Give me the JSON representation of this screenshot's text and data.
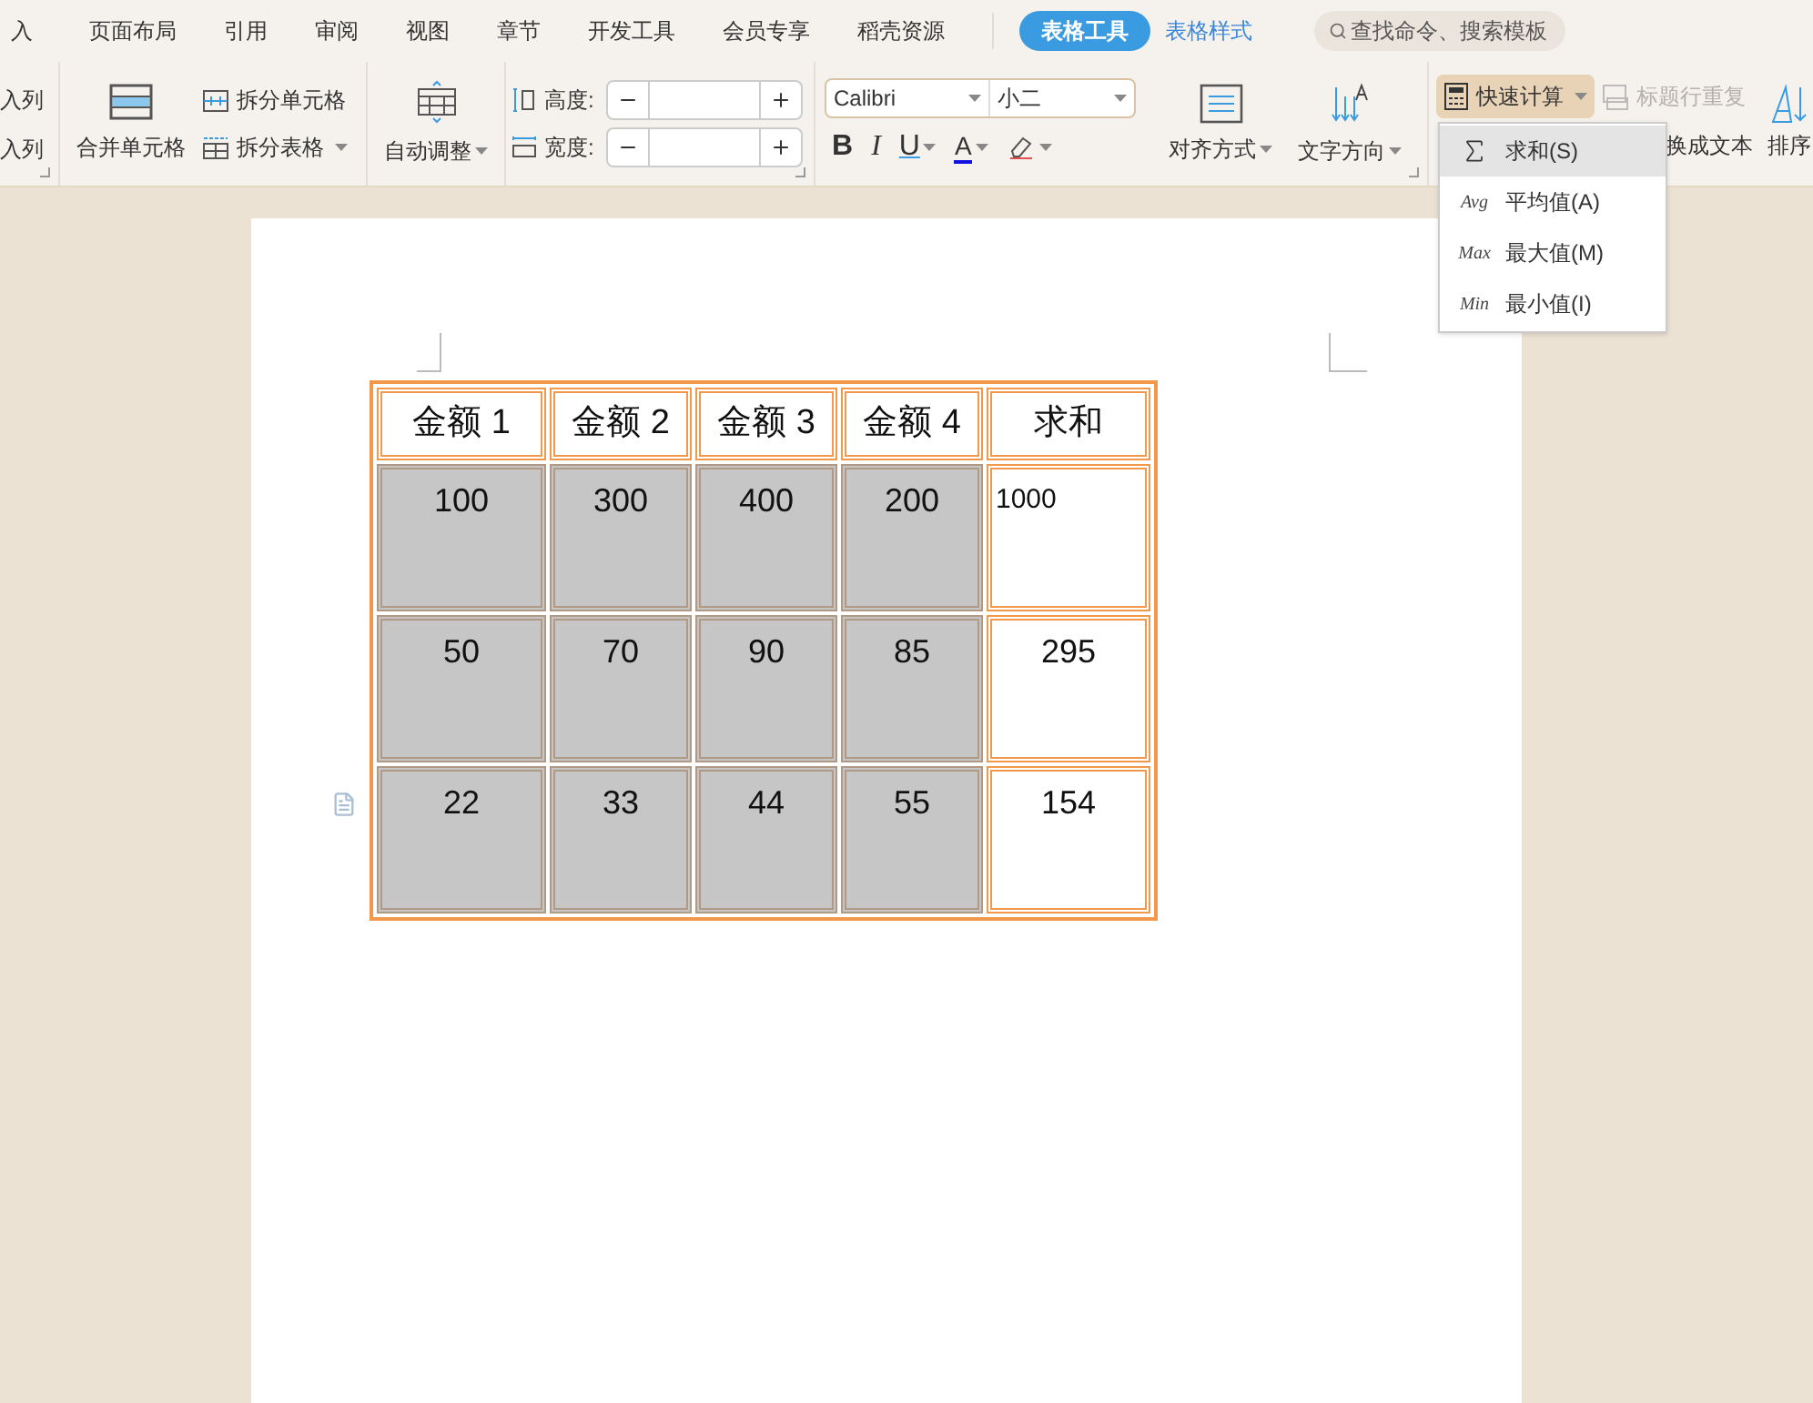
{
  "menu_tabs": [
    {
      "label": "入",
      "kind": "normal",
      "selected": false
    },
    {
      "label": "页面布局",
      "kind": "normal",
      "selected": false
    },
    {
      "label": "引用",
      "kind": "normal",
      "selected": false
    },
    {
      "label": "审阅",
      "kind": "normal",
      "selected": false
    },
    {
      "label": "视图",
      "kind": "normal",
      "selected": false
    },
    {
      "label": "章节",
      "kind": "normal",
      "selected": false
    },
    {
      "label": "开发工具",
      "kind": "normal",
      "selected": false
    },
    {
      "label": "会员专享",
      "kind": "normal",
      "selected": false
    },
    {
      "label": "稻壳资源",
      "kind": "normal",
      "selected": false
    },
    {
      "label": "表格工具",
      "kind": "contextual",
      "selected": true
    },
    {
      "label": "表格样式",
      "kind": "contextual",
      "selected": false
    }
  ],
  "search": {
    "placeholder": "查找命令、搜索模板"
  },
  "ribbon": {
    "insert_col_1": "入列",
    "insert_col_2": "入列",
    "merge_cells": "合并单元格",
    "split_cells": "拆分单元格",
    "split_table": "拆分表格",
    "auto_fit": "自动调整",
    "height_label": "高度:",
    "width_label": "宽度:",
    "font_name": "Calibri",
    "font_size": "小二",
    "bold": "B",
    "italic": "I",
    "underline": "U",
    "font_color": "A",
    "align": "对齐方式",
    "text_direction": "文字方向",
    "quick_calc": {
      "label": "快速计算",
      "expanded": true
    },
    "repeat_header": {
      "label": "标题行重复",
      "disabled": true
    },
    "convert_text": "换成文本",
    "sort": "排序"
  },
  "quick_calc_menu": [
    {
      "kind": "sigma",
      "label": "求和(S)",
      "selected": true
    },
    {
      "kind": "text",
      "icon_text": "Avg",
      "label": "平均值(A)",
      "selected": false
    },
    {
      "kind": "text",
      "icon_text": "Max",
      "label": "最大值(M)",
      "selected": false
    },
    {
      "kind": "text",
      "icon_text": "Min",
      "label": "最小值(I)",
      "selected": false
    }
  ],
  "table": {
    "header": [
      "金额 1",
      "金额 2",
      "金额 3",
      "金额 4",
      "求和"
    ],
    "rows": [
      [
        {
          "text": "100",
          "selected": true,
          "kind": "number"
        },
        {
          "text": "300",
          "selected": true,
          "kind": "number"
        },
        {
          "text": "400",
          "selected": true,
          "kind": "number"
        },
        {
          "text": "200",
          "selected": true,
          "kind": "number"
        },
        {
          "text": "1000",
          "selected": false,
          "kind": "inserted"
        }
      ],
      [
        {
          "text": "50",
          "selected": true,
          "kind": "number"
        },
        {
          "text": "70",
          "selected": true,
          "kind": "number"
        },
        {
          "text": "90",
          "selected": true,
          "kind": "number"
        },
        {
          "text": "85",
          "selected": true,
          "kind": "number"
        },
        {
          "text": "295",
          "selected": false,
          "kind": "number"
        }
      ],
      [
        {
          "text": "22",
          "selected": true,
          "kind": "number"
        },
        {
          "text": "33",
          "selected": true,
          "kind": "number"
        },
        {
          "text": "44",
          "selected": true,
          "kind": "number"
        },
        {
          "text": "55",
          "selected": true,
          "kind": "number"
        },
        {
          "text": "154",
          "selected": false,
          "kind": "number"
        }
      ]
    ]
  }
}
